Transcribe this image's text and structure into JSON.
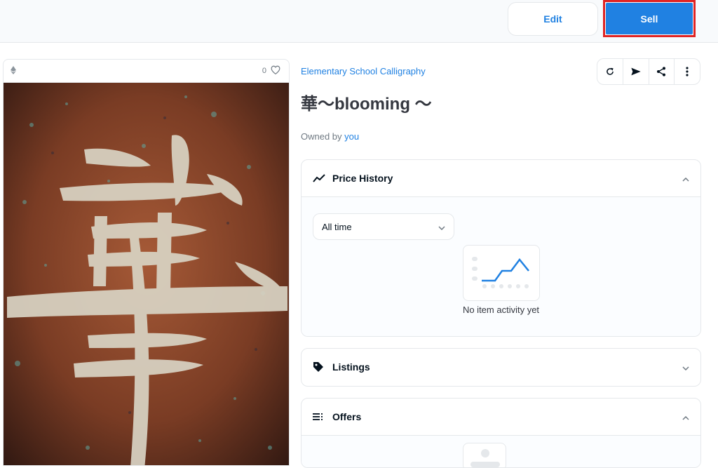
{
  "toolbar": {
    "edit_label": "Edit",
    "sell_label": "Sell"
  },
  "artwork": {
    "chain_icon": "ethereum-icon",
    "favorites_count": "0",
    "favorite_icon": "heart-icon",
    "image_description_colors": {
      "background": "#7a3c24",
      "stroke": "#d9d4c4"
    }
  },
  "item": {
    "collection_name": "Elementary School Calligraphy",
    "title": "華〜blooming 〜",
    "owned_by_label": "Owned by",
    "owner": "you"
  },
  "actions": {
    "icons": [
      "refresh-icon",
      "transfer-icon",
      "share-icon",
      "more-icon"
    ]
  },
  "price_history": {
    "label": "Price History",
    "range_selected": "All time",
    "empty_text": "No item activity yet"
  },
  "listings": {
    "label": "Listings"
  },
  "offers": {
    "label": "Offers"
  },
  "colors": {
    "accent": "#2081e2",
    "highlight": "#e02424"
  }
}
